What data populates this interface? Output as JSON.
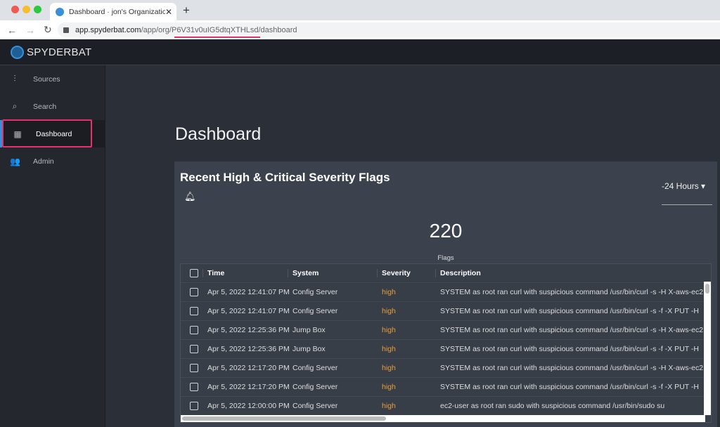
{
  "browser": {
    "tab_title": "Dashboard · jon's Organization",
    "url_domain": "app.spyderbat.com",
    "url_path": "/app/org/P6V31v0uIG5dtqXTHLsd/dashboard"
  },
  "app": {
    "brand": "SPYDERBAT"
  },
  "sidebar": {
    "items": [
      {
        "label": "Sources",
        "icon": "remote-icon"
      },
      {
        "label": "Search",
        "icon": "search-icon"
      },
      {
        "label": "Dashboard",
        "icon": "dashboard-icon",
        "active": true
      },
      {
        "label": "Admin",
        "icon": "people-icon"
      }
    ]
  },
  "page": {
    "title": "Dashboard"
  },
  "card": {
    "title": "Recent High & Critical Severity Flags",
    "range": "-24 Hours",
    "count": "220",
    "count_label": "Flags"
  },
  "table": {
    "headers": [
      "Time",
      "System",
      "Severity",
      "Description"
    ],
    "rows": [
      [
        "Apr 5, 2022 12:41:07 PM",
        "Config Server",
        "high",
        "SYSTEM as root ran curl with suspicious command /usr/bin/curl -s -H X-aws-ec2"
      ],
      [
        "Apr 5, 2022 12:41:07 PM",
        "Config Server",
        "high",
        "SYSTEM as root ran curl with suspicious command /usr/bin/curl -s -f -X PUT -H"
      ],
      [
        "Apr 5, 2022 12:25:36 PM",
        "Jump Box",
        "high",
        "SYSTEM as root ran curl with suspicious command /usr/bin/curl -s -H X-aws-ec2"
      ],
      [
        "Apr 5, 2022 12:25:36 PM",
        "Jump Box",
        "high",
        "SYSTEM as root ran curl with suspicious command /usr/bin/curl -s -f -X PUT -H"
      ],
      [
        "Apr 5, 2022 12:17:20 PM",
        "Config Server",
        "high",
        "SYSTEM as root ran curl with suspicious command /usr/bin/curl -s -H X-aws-ec2"
      ],
      [
        "Apr 5, 2022 12:17:20 PM",
        "Config Server",
        "high",
        "SYSTEM as root ran curl with suspicious command /usr/bin/curl -s -f -X PUT -H"
      ],
      [
        "Apr 5, 2022 12:00:00 PM",
        "Config Server",
        "high",
        "ec2-user as root ran sudo with suspicious command /usr/bin/sudo su"
      ]
    ]
  },
  "colors": {
    "accent": "#3a8fd6",
    "severity_high": "#e89c3a",
    "highlight": "#e8306b"
  }
}
